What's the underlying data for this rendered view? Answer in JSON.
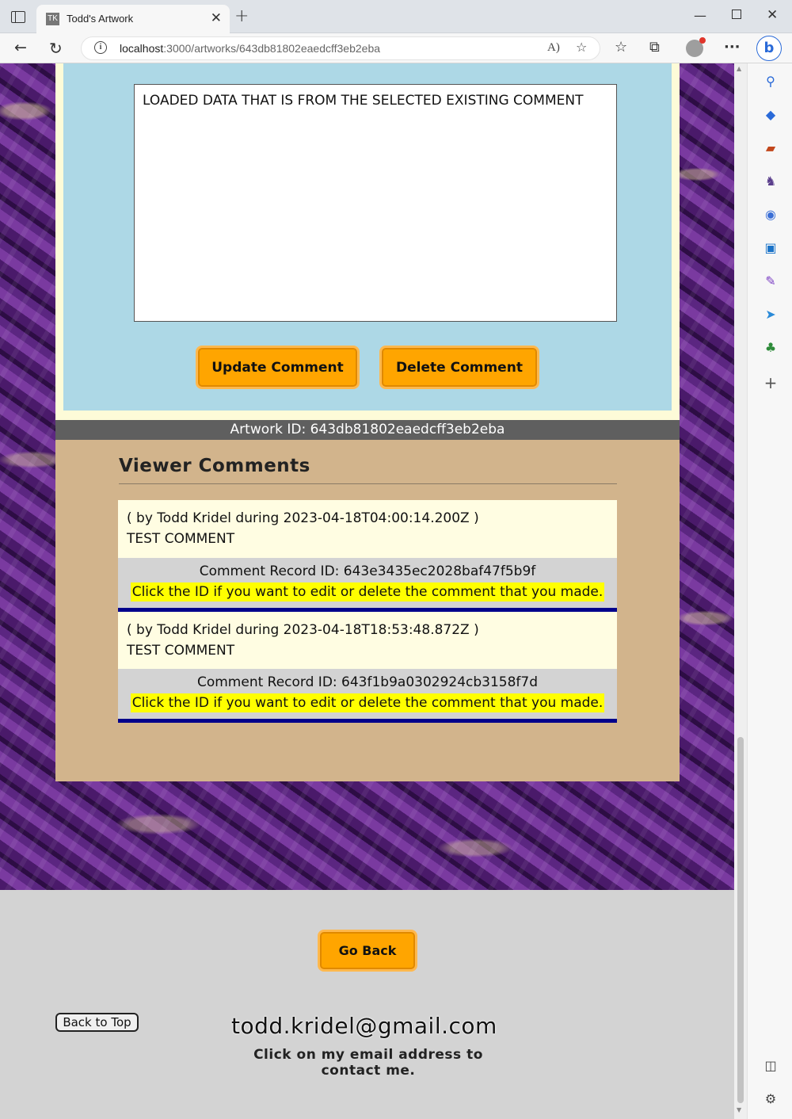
{
  "browser": {
    "tab_title": "Todd's Artwork",
    "tab_favicon_text": "TK",
    "url_host": "localhost",
    "url_rest": ":3000/artworks/643db81802eaedcff3eb2eba"
  },
  "editor": {
    "textarea_value": "LOADED DATA THAT IS FROM THE SELECTED EXISTING COMMENT",
    "update_label": "Update Comment",
    "delete_label": "Delete Comment"
  },
  "artwork": {
    "id_label": "Artwork ID: 643db81802eaedcff3eb2eba"
  },
  "comments_section": {
    "heading": "Viewer Comments",
    "comments": [
      {
        "meta": "( by Todd Kridel during 2023-04-18T04:00:14.200Z )",
        "text": "TEST COMMENT",
        "record_label": "Comment Record ID: ",
        "record_id": "643e3435ec2028baf47f5b9f",
        "hint": "Click the ID if you want to edit or delete the comment that you made."
      },
      {
        "meta": "( by Todd Kridel during 2023-04-18T18:53:48.872Z )",
        "text": "TEST COMMENT",
        "record_label": "Comment Record ID: ",
        "record_id": "643f1b9a0302924cb3158f7d",
        "hint": "Click the ID if you want to edit or delete the comment that you made."
      }
    ]
  },
  "footer": {
    "go_back_label": "Go Back",
    "back_to_top_label": "Back to Top",
    "email": "todd.kridel@gmail.com",
    "email_caption": "Click on my email address to contact me."
  },
  "colors": {
    "accent_orange": "#ffa500",
    "panel_blue": "#add8e6",
    "tan": "#d2b48c",
    "comment_divider": "#00008b",
    "hint_highlight": "#ffff00"
  }
}
